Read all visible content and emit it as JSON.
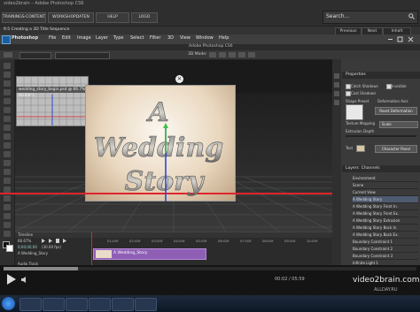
{
  "site": {
    "title": "video2brain – Adobe Photoshop CS6",
    "tabs": [
      "TRAININGS-CONTENT",
      "WORKSHOPDATEN",
      "HELP",
      "LOGO"
    ],
    "search_placeholder": "Search...",
    "lesson": "9.5 Creating a 3D Title Sequence",
    "nav": [
      "Previous",
      "Next",
      "Inhalt"
    ]
  },
  "app": {
    "name": "Photoshop",
    "window_title": "Adobe Photoshop CS6",
    "menus": [
      "File",
      "Edit",
      "Image",
      "Layer",
      "Type",
      "Select",
      "Filter",
      "3D",
      "View",
      "Window",
      "Help"
    ],
    "options_mode": "3D Mode:",
    "document_tab": "wedding_story_begin.psd @ 66.7% (A Wedding_Story, RGB/8*)"
  },
  "canvas": {
    "title_line1": "A",
    "title_line2": "Wedding",
    "title_line3": "Story",
    "colors": {
      "accent_red": "#e0242b",
      "gizmo_blue": "#2a4ad8",
      "gizmo_green": "#3fbf4a"
    }
  },
  "properties": {
    "header": "Properties",
    "checks": [
      "Catch Shadows",
      "Invisible",
      "Cast Shadows"
    ],
    "shape_preset": "Shape Preset",
    "deformation_axis": "Deformation Axis",
    "reset_deformation": "Reset Deformation",
    "texture_mapping_label": "Texture Mapping",
    "texture_mapping_value": "Scale",
    "extrusion_depth_label": "Extrusion Depth",
    "source_label": "Text",
    "character_panel": "Character Panel"
  },
  "layers": {
    "header": "Layers",
    "tab2": "Channels",
    "items": [
      "Environment",
      "Scene",
      "Current View",
      "A Wedding Story",
      "A Wedding Story Front In.",
      "A Wedding Story Front Ex.",
      "A Wedding Story Extrusion",
      "A Wedding Story Back In.",
      "A Wedding Story Back Ex.",
      "Boundary Constraint 1",
      "Boundary Constraint 2",
      "Boundary Constraint 3",
      "Infinite Light 1"
    ]
  },
  "timeline": {
    "header": "Timeline",
    "time": "0;00;00;00",
    "fps": "(30.00 fps)",
    "ticks": [
      "01:00f",
      "02:00f",
      "03:00f",
      "04:00f",
      "05:00f",
      "06:00f",
      "07:00f",
      "08:00f",
      "09:00f",
      "10:00f"
    ],
    "clip_label": "A Wedding_Story",
    "track1": "A Wedding_Story",
    "track2": "Audio Track",
    "zoom": "66.67%"
  },
  "player": {
    "brand": "video2brain.com",
    "watermark": "ALLDAY.RU",
    "time": "00:02 / 05:59",
    "progress_fraction": 0.18
  }
}
